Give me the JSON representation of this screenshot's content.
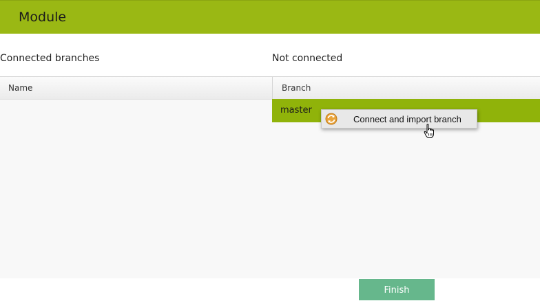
{
  "header": {
    "title": "Module"
  },
  "sections": {
    "connected_label": "Connected branches",
    "not_connected_label": "Not connected"
  },
  "table": {
    "name_header": "Name",
    "branch_header": "Branch",
    "branches": [
      "master"
    ]
  },
  "context_menu": {
    "items": [
      {
        "label": "Connect and import branch",
        "icon": "sync-icon"
      }
    ]
  },
  "footer": {
    "finish_label": "Finish"
  },
  "colors": {
    "header_bg": "#9ab814",
    "row_selected": "#90b30a",
    "finish_button": "#66b78c"
  }
}
